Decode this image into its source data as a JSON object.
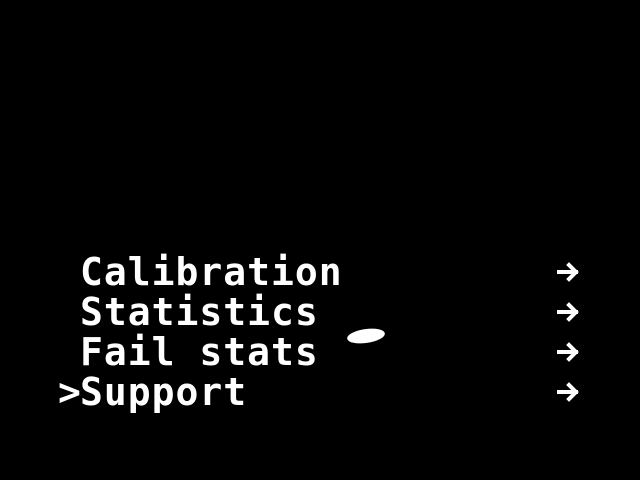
{
  "menu": {
    "cursor_symbol": ">",
    "selected_index": 3,
    "items": [
      {
        "label": "Calibration",
        "icon": "arrow-right-icon"
      },
      {
        "label": "Statistics",
        "icon": "arrow-right-icon"
      },
      {
        "label": "Fail stats",
        "icon": "arrow-right-icon"
      },
      {
        "label": "Support",
        "icon": "arrow-right-icon"
      }
    ]
  },
  "colors": {
    "background": "#000000",
    "foreground": "#ffffff"
  }
}
